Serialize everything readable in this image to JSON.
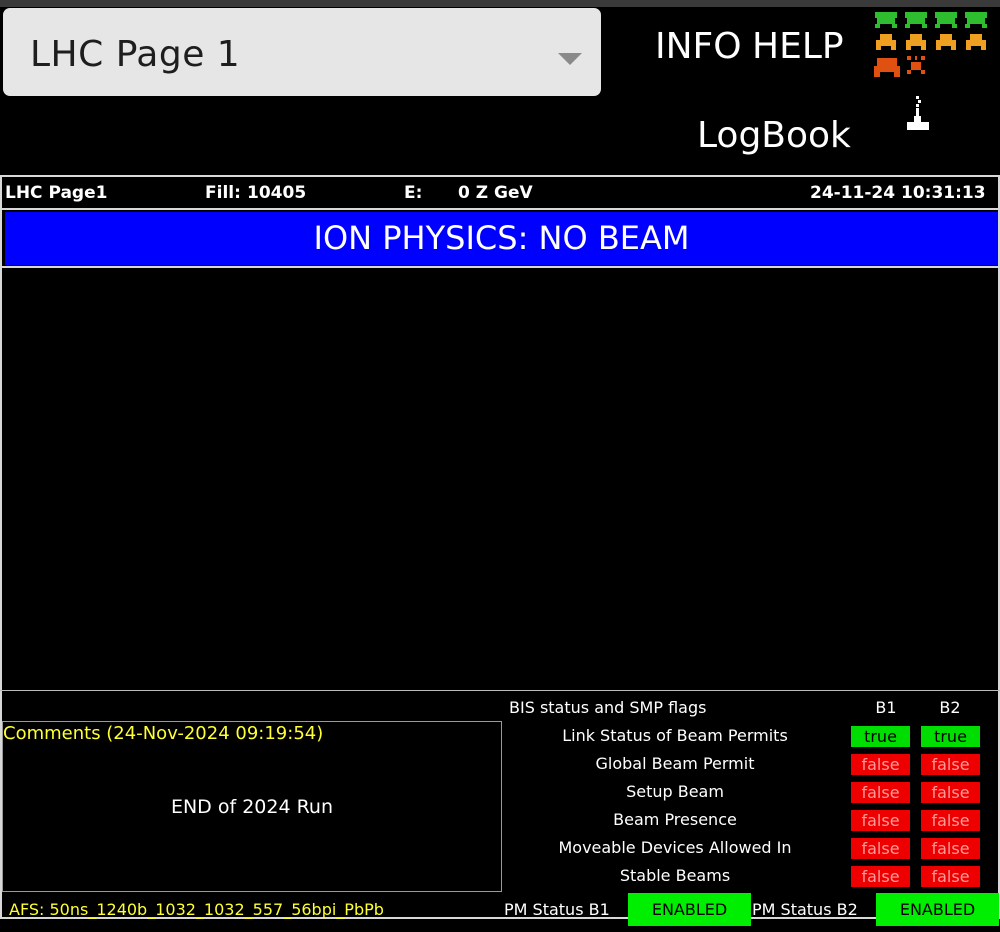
{
  "page_selector": {
    "value": "LHC Page 1"
  },
  "links": {
    "info": "INFO",
    "help": "HELP",
    "logbook": "LogBook"
  },
  "icons": {
    "arcade": "space-invaders-icon",
    "joystick": "joystick-icon"
  },
  "header": {
    "page": "LHC Page1",
    "fill_label": "Fill:",
    "fill_value": "10405",
    "energy_label": "E:",
    "energy_value": "0 Z GeV",
    "datetime": "24-11-24 10:31:13"
  },
  "status_banner": "ION PHYSICS: NO BEAM",
  "comments": {
    "title": "Comments (24-Nov-2024 09:19:54)",
    "text": "END of 2024 Run"
  },
  "bis": {
    "title": "BIS status and SMP flags",
    "columns": [
      "B1",
      "B2"
    ],
    "rows": [
      {
        "label": "Link Status of Beam Permits",
        "b1": "true",
        "b2": "true"
      },
      {
        "label": "Global Beam Permit",
        "b1": "false",
        "b2": "false"
      },
      {
        "label": "Setup Beam",
        "b1": "false",
        "b2": "false"
      },
      {
        "label": "Beam Presence",
        "b1": "false",
        "b2": "false"
      },
      {
        "label": "Moveable Devices Allowed In",
        "b1": "false",
        "b2": "false"
      },
      {
        "label": "Stable Beams",
        "b1": "false",
        "b2": "false"
      }
    ]
  },
  "footer": {
    "afs": "AFS: 50ns_1240b_1032_1032_557_56bpi_PbPb",
    "pm_b1_label": "PM Status B1",
    "pm_b1_value": "ENABLED",
    "pm_b2_label": "PM Status B2",
    "pm_b2_value": "ENABLED"
  },
  "colors": {
    "banner": "#0000ff",
    "true_flag": "#00dd00",
    "false_flag": "#ee0000",
    "comment_title": "#ffff33",
    "enabled": "#00ee00"
  }
}
